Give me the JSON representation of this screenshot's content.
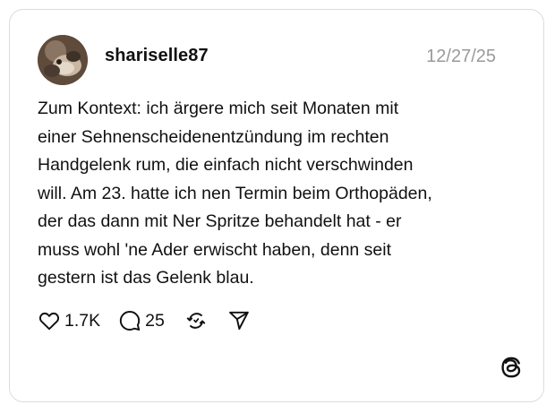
{
  "post": {
    "username": "shariselle87",
    "timestamp": "12/27/25",
    "text": "Zum Kontext: ich ärgere mich seit Monaten mit\neiner Sehnenscheidenentzündung im rechten\nHandgelenk rum, die einfach nicht verschwinden\nwill. Am 23. hatte ich nen Termin beim Orthopäden,\nder das dann mit Ner Spritze behandelt hat - er\nmuss wohl 'ne Ader erwischt haben, denn seit\ngestern ist das Gelenk blau.",
    "avatar_icon": "profile-photo"
  },
  "actions": {
    "likes": "1.7K",
    "replies": "25",
    "icons": [
      "heart-icon",
      "comment-icon",
      "repost-icon",
      "share-icon"
    ]
  },
  "branding": {
    "logo_icon": "threads-logo-icon"
  },
  "colors": {
    "border": "#dcdcdc",
    "text": "#111111",
    "muted": "#9a9a9a"
  }
}
